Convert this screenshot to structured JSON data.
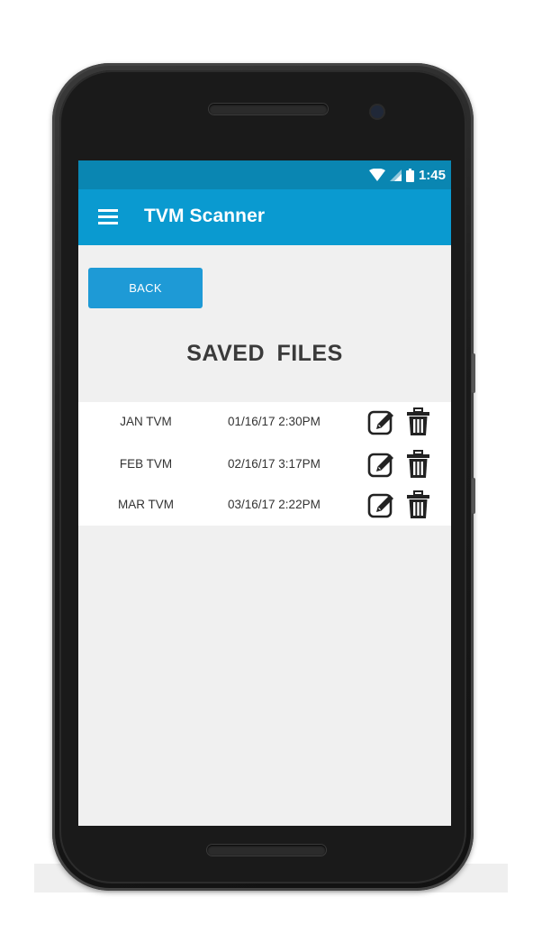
{
  "status_bar": {
    "time": "1:45",
    "icons": [
      "wifi-icon",
      "signal-icon",
      "battery-icon"
    ]
  },
  "app_bar": {
    "title": "TVM Scanner",
    "menu_icon": "hamburger-menu-icon"
  },
  "back_button": {
    "label": "BACK"
  },
  "page_title": "SAVED  FILES",
  "files": [
    {
      "name": "JAN TVM",
      "date": "01/16/17 2:30PM"
    },
    {
      "name": "FEB TVM",
      "date": "02/16/17 3:17PM"
    },
    {
      "name": "MAR TVM",
      "date": "03/16/17 2:22PM"
    }
  ],
  "row_actions": [
    "edit-icon",
    "trash-icon"
  ],
  "colors": {
    "status_bar": "#0a86b2",
    "app_bar": "#0a9ad0",
    "button": "#1e9ad6",
    "screen_bg": "#f0f0f0",
    "list_bg": "#ffffff",
    "text": "#333333"
  }
}
